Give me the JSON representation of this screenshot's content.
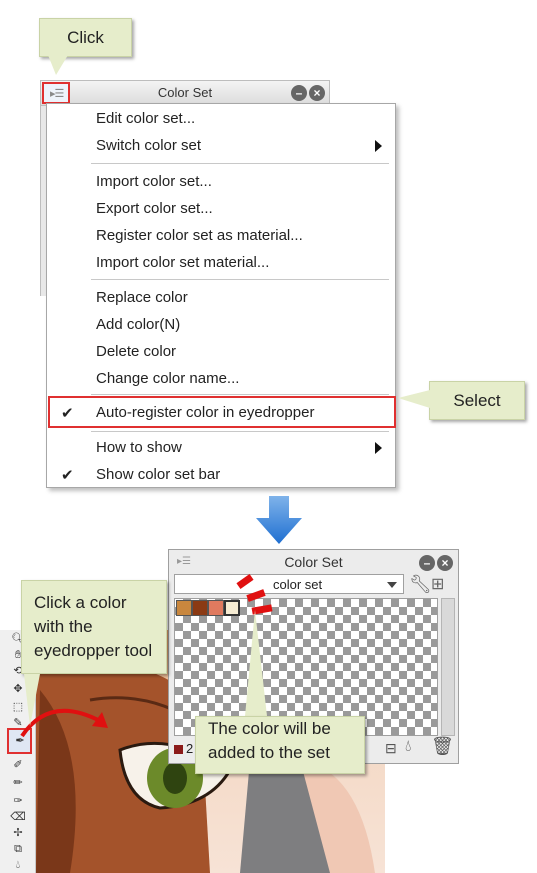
{
  "callouts": {
    "click": "Click",
    "select": "Select",
    "eyedropper": [
      "Click a color",
      "with the",
      "eyedropper tool"
    ],
    "added": [
      "The color will be",
      "added to the set"
    ]
  },
  "top_panel": {
    "title": "Color Set",
    "menu_icon": "panel-menu-icon"
  },
  "menu": {
    "items": [
      {
        "label": "Edit color set..."
      },
      {
        "label": "Switch color set",
        "submenu": true
      },
      {
        "label": "Import color set..."
      },
      {
        "label": "Export color set..."
      },
      {
        "label": "Register color set as material..."
      },
      {
        "label": "Import color set material..."
      },
      {
        "label": "Replace color"
      },
      {
        "label": "Add color(N)"
      },
      {
        "label": "Delete color"
      },
      {
        "label": "Change color name..."
      },
      {
        "label": "Auto-register color in eyedropper",
        "checked": true,
        "highlighted": true
      },
      {
        "label": "How to show",
        "submenu": true
      },
      {
        "label": "Show color set bar",
        "checked": true
      }
    ]
  },
  "bottom_panel": {
    "title": "Color Set",
    "dropdown_value": "color set",
    "swatches": [
      "#c9873e",
      "#8b3a14",
      "#e07a5f",
      "#f6ecd3"
    ],
    "current_color": "#8b1a1a",
    "count_text": "2"
  },
  "colors": {
    "highlight": "#e03030",
    "callout_bg": "#e6edcb",
    "arrow_blue": "#1f6fd1"
  }
}
